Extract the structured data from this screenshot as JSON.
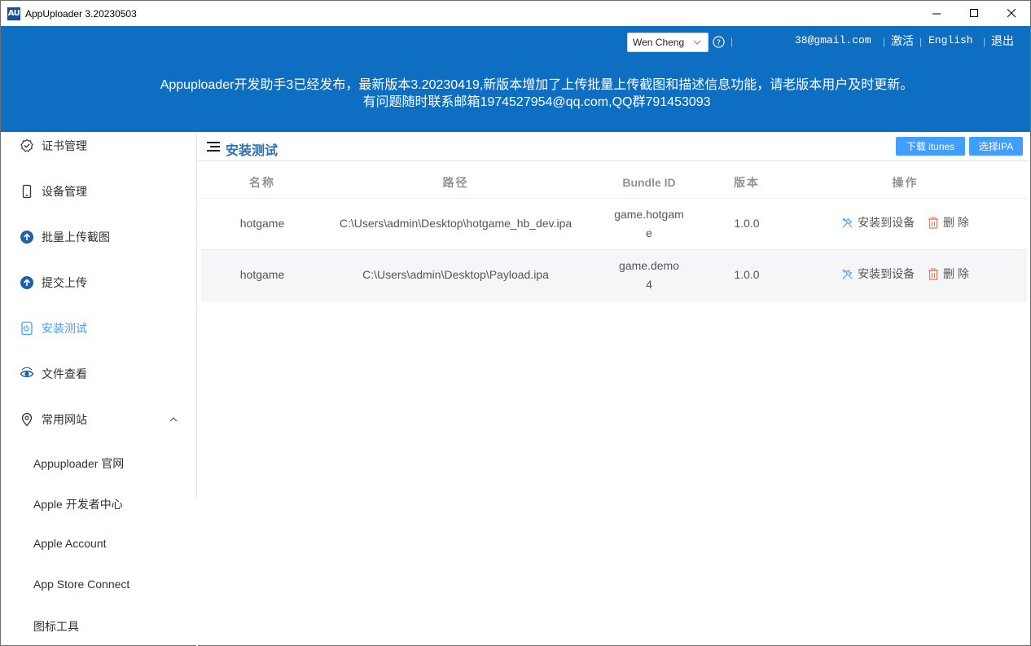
{
  "window": {
    "logo": "AU",
    "title": "AppUploader 3.20230503"
  },
  "header": {
    "user_select": "Wen Cheng",
    "email": "38@gmail.com",
    "activate": "激活",
    "language": "English",
    "logout": "退出",
    "separator": "|",
    "announcement_line1": "Appuploader开发助手3已经发布，最新版本3.20230419,新版本增加了上传批量上传截图和描述信息功能，请老版本用户及时更新。",
    "announcement_line2": "有问题随时联系邮箱1974527954@qq.com,QQ群791453093"
  },
  "sidebar": {
    "items": [
      {
        "label": "证书管理",
        "icon": "certificate-icon"
      },
      {
        "label": "设备管理",
        "icon": "device-icon"
      },
      {
        "label": "批量上传截图",
        "icon": "upload-circle-icon"
      },
      {
        "label": "提交上传",
        "icon": "upload-circle-icon"
      },
      {
        "label": "安装测试",
        "icon": "install-test-icon"
      },
      {
        "label": "文件查看",
        "icon": "file-view-icon"
      },
      {
        "label": "常用网站",
        "icon": "location-icon"
      }
    ],
    "subitems": [
      "Appuploader 官网",
      "Apple 开发者中心",
      "Apple Account",
      "App Store Connect",
      "图标工具"
    ]
  },
  "main": {
    "title": "安装测试",
    "btn_download": "下载 itunes",
    "btn_select": "选择IPA",
    "columns": [
      "名称",
      "路径",
      "Bundle ID",
      "版本",
      "操作"
    ],
    "rows": [
      {
        "name": "hotgame",
        "path": "C:\\Users\\admin\\Desktop\\hotgame_hb_dev.ipa",
        "bundle": "game.hotgame",
        "version": "1.0.0",
        "install": "安装到设备",
        "delete": "删 除"
      },
      {
        "name": "hotgame",
        "path": "C:\\Users\\admin\\Desktop\\Payload.ipa",
        "bundle": "game.demo4",
        "version": "1.0.0",
        "install": "安装到设备",
        "delete": "删 除"
      }
    ]
  },
  "colors": {
    "header_bg": "#0e6fc2",
    "accent": "#409eff",
    "title_blue": "#2c6fb3",
    "delete_red": "#e6794f"
  }
}
